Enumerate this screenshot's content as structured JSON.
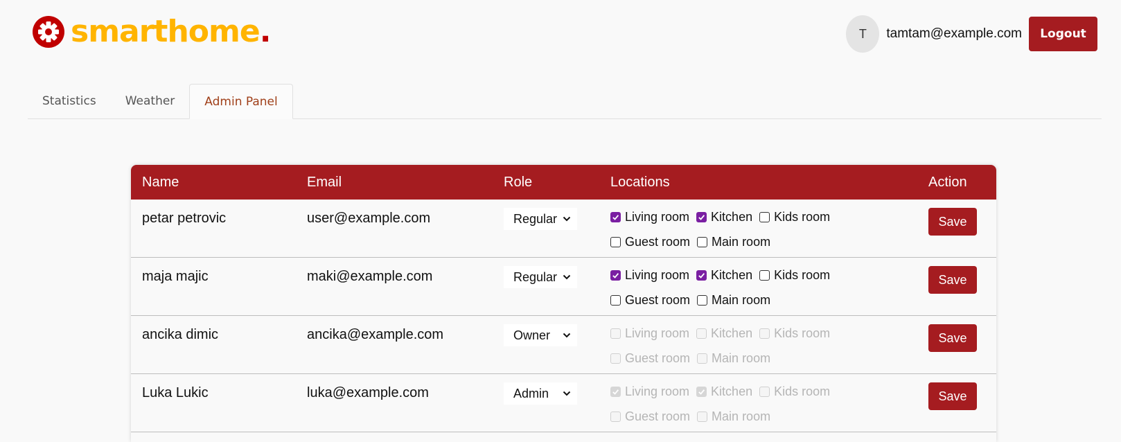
{
  "header": {
    "logo_text": "smarthome",
    "logo_dot": ".",
    "avatar_initial": "T",
    "user_email": "tamtam@example.com",
    "logout_label": "Logout"
  },
  "tabs": [
    {
      "label": "Statistics",
      "active": false
    },
    {
      "label": "Weather",
      "active": false
    },
    {
      "label": "Admin Panel",
      "active": true
    }
  ],
  "table": {
    "columns": [
      "Name",
      "Email",
      "Role",
      "Locations",
      "Action"
    ],
    "rows": [
      {
        "name": "petar petrovic",
        "email": "user@example.com",
        "role": "Regular",
        "locations_disabled": false,
        "save_label": "Save",
        "locations": [
          {
            "label": "Living room",
            "checked": true
          },
          {
            "label": "Kitchen",
            "checked": true
          },
          {
            "label": "Kids room",
            "checked": false
          },
          {
            "label": "Guest room",
            "checked": false
          },
          {
            "label": "Main room",
            "checked": false
          }
        ]
      },
      {
        "name": "maja majic",
        "email": "maki@example.com",
        "role": "Regular",
        "locations_disabled": false,
        "save_label": "Save",
        "locations": [
          {
            "label": "Living room",
            "checked": true
          },
          {
            "label": "Kitchen",
            "checked": true
          },
          {
            "label": "Kids room",
            "checked": false
          },
          {
            "label": "Guest room",
            "checked": false
          },
          {
            "label": "Main room",
            "checked": false
          }
        ]
      },
      {
        "name": "ancika dimic",
        "email": "ancika@example.com",
        "role": "Owner",
        "locations_disabled": true,
        "save_label": "Save",
        "locations": [
          {
            "label": "Living room",
            "checked": false
          },
          {
            "label": "Kitchen",
            "checked": false
          },
          {
            "label": "Kids room",
            "checked": false
          },
          {
            "label": "Guest room",
            "checked": false
          },
          {
            "label": "Main room",
            "checked": false
          }
        ]
      },
      {
        "name": "Luka Lukic",
        "email": "luka@example.com",
        "role": "Admin",
        "locations_disabled": true,
        "save_label": "Save",
        "locations": [
          {
            "label": "Living room",
            "checked": true
          },
          {
            "label": "Kitchen",
            "checked": true
          },
          {
            "label": "Kids room",
            "checked": false
          },
          {
            "label": "Guest room",
            "checked": false
          },
          {
            "label": "Main room",
            "checked": false
          }
        ]
      }
    ]
  },
  "colors": {
    "brand_red": "#a51c20",
    "logo_yellow": "#ffb400",
    "checkbox_purple": "#7a1fa2"
  },
  "icons": {
    "logo": "gear-icon",
    "select": "chevron-down-icon",
    "checkbox": "checkmark-icon"
  }
}
